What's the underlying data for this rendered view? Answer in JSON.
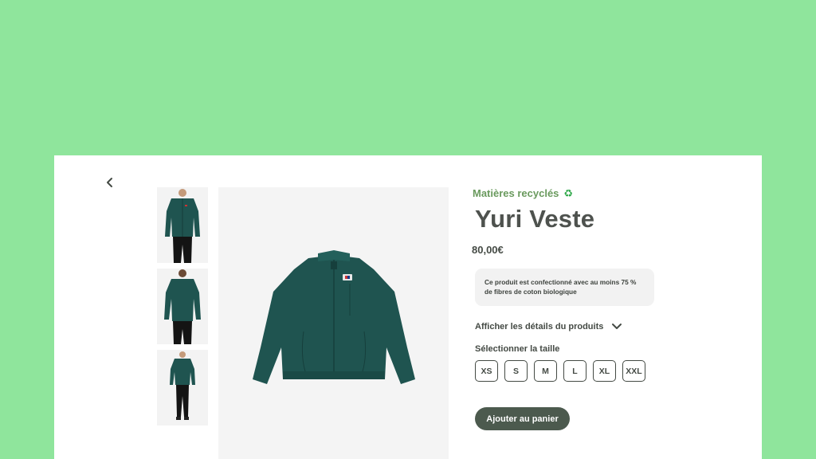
{
  "product": {
    "eyebrow": "Matières recyclés",
    "eyebrow_icon": "recycle-icon",
    "eyebrow_glyph": "♻",
    "title": "Yuri Veste",
    "price": "80,00€",
    "note": "Ce produit est confectionné avec au moins 75 % de fibres de coton biologique",
    "details_label": "Afficher les détails du produits",
    "size_label": "Sélectionner la taille",
    "sizes": [
      "XS",
      "S",
      "M",
      "L",
      "XL",
      "XXL"
    ],
    "cart_label": "Ajouter au panier"
  },
  "gallery": {
    "thumbnails": [
      "thumbnail-front-model",
      "thumbnail-back-model",
      "thumbnail-full-body-model"
    ],
    "main": "jacket-product-image"
  },
  "colors": {
    "background": "#8fe59c",
    "accent_green": "#6a9a5e",
    "button": "#4c5a4e",
    "jacket": "#1f5450"
  }
}
